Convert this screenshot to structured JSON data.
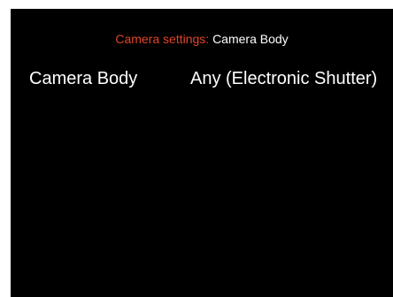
{
  "header": {
    "prefix": "Camera settings:",
    "value": "Camera Body"
  },
  "settings": [
    {
      "label": "Camera Body",
      "value": "Any (Electronic Shutter)"
    }
  ],
  "colors": {
    "background": "#000000",
    "header_prefix": "#e0452a",
    "text": "#ffffff"
  }
}
